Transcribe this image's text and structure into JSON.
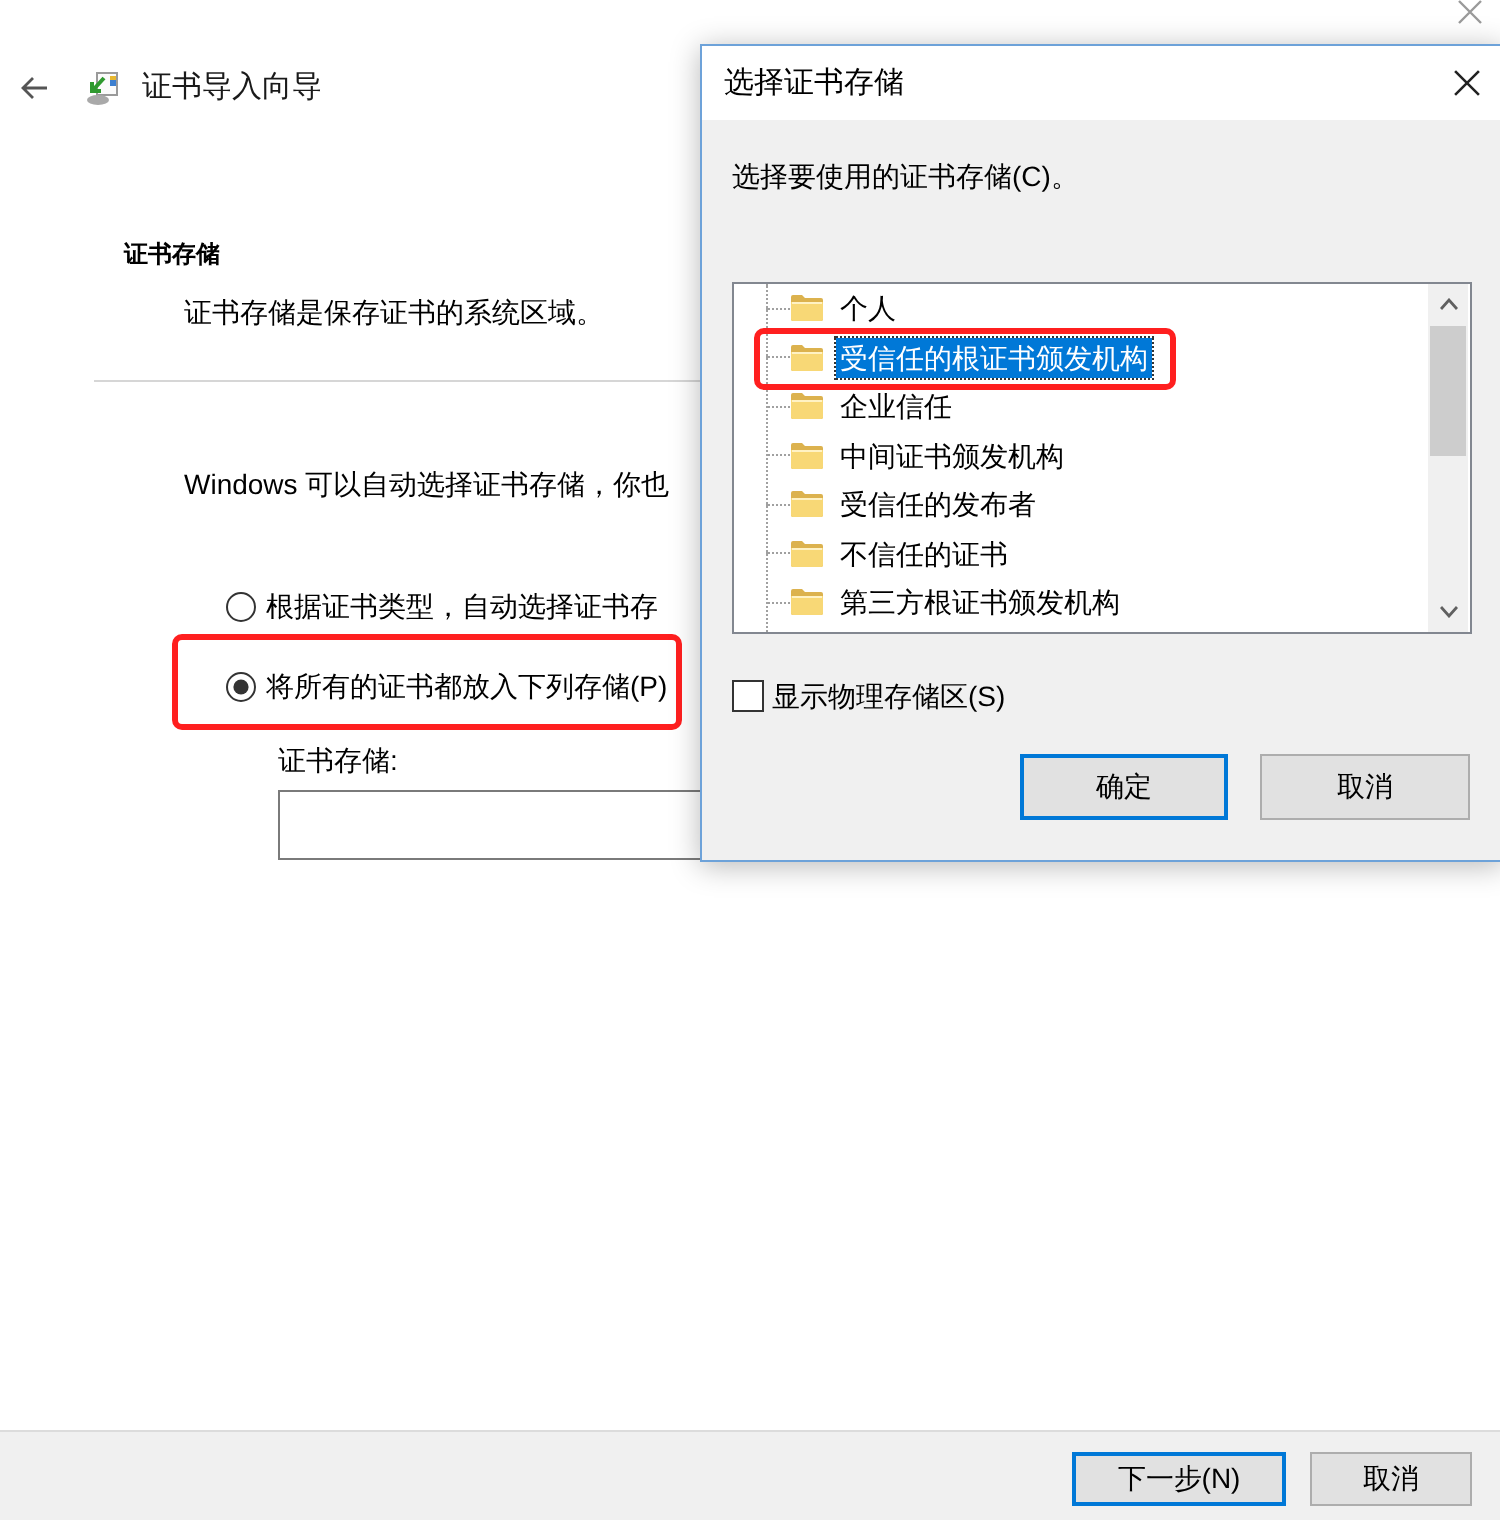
{
  "wizard": {
    "title": "证书导入向导",
    "section_title": "证书存储",
    "section_description": "证书存储是保存证书的系统区域。",
    "intro": "Windows 可以自动选择证书存储，你也",
    "options": [
      {
        "label": "根据证书类型，自动选择证书存",
        "selected": false,
        "annotated": false
      },
      {
        "label": "将所有的证书都放入下列存储(P)",
        "selected": true,
        "annotated": true
      }
    ],
    "store_field": {
      "label": "证书存储:"
    },
    "buttons": [
      {
        "label": "下一步(N)",
        "default": true
      },
      {
        "label": "取消",
        "default": false
      }
    ]
  },
  "dialog": {
    "title": "选择证书存储",
    "prompt": "选择要使用的证书存储(C)。",
    "stores": [
      {
        "label": "个人",
        "selected": false,
        "annotated": false
      },
      {
        "label": "受信任的根证书颁发机构",
        "selected": true,
        "annotated": true
      },
      {
        "label": "企业信任",
        "selected": false,
        "annotated": false
      },
      {
        "label": "中间证书颁发机构",
        "selected": false,
        "annotated": false
      },
      {
        "label": "受信任的发布者",
        "selected": false,
        "annotated": false
      },
      {
        "label": "不信任的证书",
        "selected": false,
        "annotated": false
      },
      {
        "label": "第三方根证书颁发机构",
        "selected": false,
        "annotated": false
      }
    ],
    "show_physical": {
      "label": "显示物理存储区(S)",
      "checked": false
    },
    "buttons": [
      {
        "label": "确定",
        "default": true
      },
      {
        "label": "取消",
        "default": false
      }
    ]
  }
}
